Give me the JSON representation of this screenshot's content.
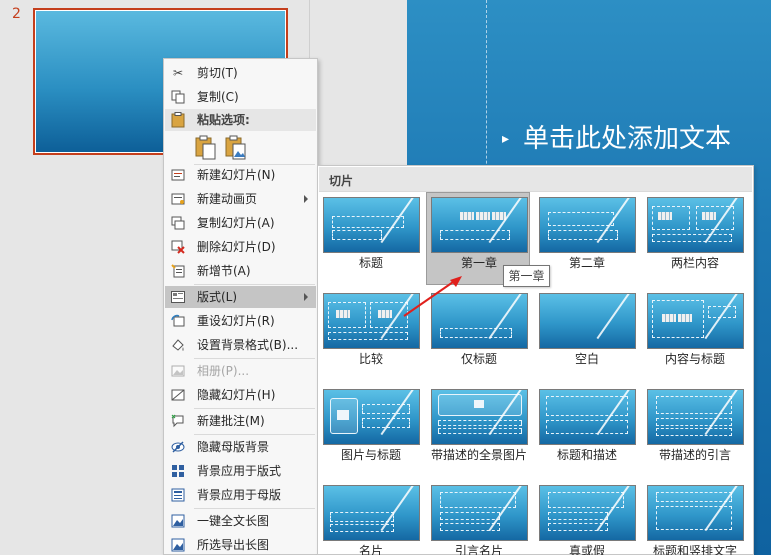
{
  "thumbnails": {
    "slide_number": "2"
  },
  "slide": {
    "body_text": "单击此处添加文本",
    "bullet": "▸"
  },
  "context_menu": {
    "items": [
      {
        "icon": "scissors-icon",
        "label": "剪切(T)"
      },
      {
        "icon": "copy-icon",
        "label": "复制(C)"
      },
      {
        "icon": "clipboard-icon",
        "label": "粘贴选项:"
      },
      {
        "icon": "new-slide-icon",
        "label": "新建幻灯片(N)"
      },
      {
        "icon": "new-animation-page-icon",
        "label": "新建动画页"
      },
      {
        "icon": "duplicate-slide-icon",
        "label": "复制幻灯片(A)"
      },
      {
        "icon": "delete-slide-icon",
        "label": "删除幻灯片(D)"
      },
      {
        "icon": "new-section-icon",
        "label": "新增节(A)"
      },
      {
        "icon": "layout-icon",
        "label": "版式(L)"
      },
      {
        "icon": "reset-slide-icon",
        "label": "重设幻灯片(R)"
      },
      {
        "icon": "format-background-icon",
        "label": "设置背景格式(B)..."
      },
      {
        "icon": "album-icon",
        "label": "相册(P)..."
      },
      {
        "icon": "hide-slide-icon",
        "label": "隐藏幻灯片(H)"
      },
      {
        "icon": "new-comment-icon",
        "label": "新建批注(M)"
      },
      {
        "icon": "hide-master-bg-icon",
        "label": "隐藏母版背景"
      },
      {
        "icon": "apply-bg-layout-icon",
        "label": "背景应用于版式"
      },
      {
        "icon": "apply-bg-master-icon",
        "label": "背景应用于母版"
      },
      {
        "icon": "long-image-icon",
        "label": "一键全文长图"
      },
      {
        "icon": "export-long-image-icon",
        "label": "所选导出长图"
      }
    ]
  },
  "gallery": {
    "header": "切片",
    "tooltip": "第一章",
    "layouts": [
      {
        "label": "标题"
      },
      {
        "label": "第一章"
      },
      {
        "label": "第二章"
      },
      {
        "label": "两栏内容"
      },
      {
        "label": "比较"
      },
      {
        "label": "仅标题"
      },
      {
        "label": "空白"
      },
      {
        "label": "内容与标题"
      },
      {
        "label": "图片与标题"
      },
      {
        "label": "带描述的全景图片"
      },
      {
        "label": "标题和描述"
      },
      {
        "label": "带描述的引言"
      },
      {
        "label": "名片"
      },
      {
        "label": "引言名片"
      },
      {
        "label": "真或假"
      },
      {
        "label": "标题和竖排文字"
      }
    ]
  },
  "colors": {
    "accent_red": "#c43e1c",
    "slide_blue": "#1d78b3",
    "arrow_red": "#e0201c"
  }
}
